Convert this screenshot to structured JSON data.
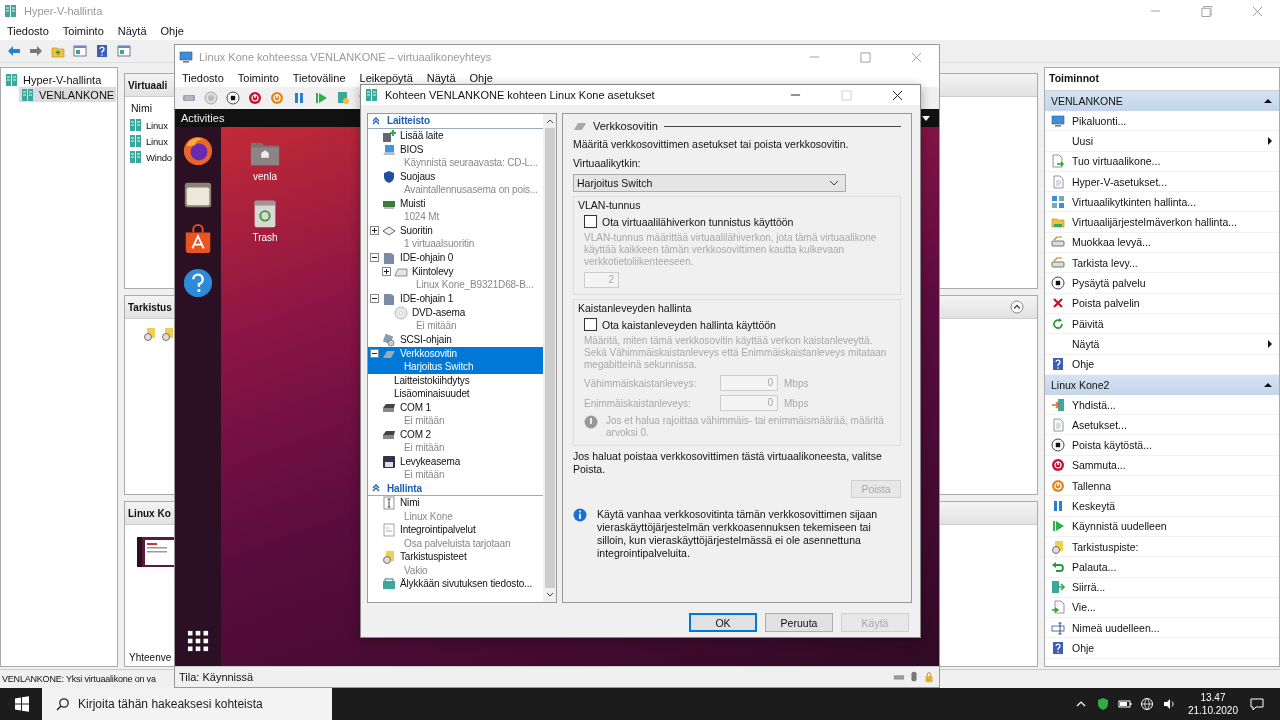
{
  "manager": {
    "title": "Hyper-V-hallinta",
    "menu": [
      "Tiedosto",
      "Toiminto",
      "Näytä",
      "Ohje"
    ],
    "tree": [
      {
        "label": "Hyper-V-hallinta",
        "selected": false,
        "children": [
          {
            "label": "VENLANKONE",
            "selected": true
          }
        ]
      }
    ],
    "vm_pane": {
      "title": "Virtuaali",
      "header": "Nimi",
      "rows": [
        "Linux",
        "Linux",
        "Windo"
      ]
    },
    "checkpoint_pane": {
      "title": "Tarkistus"
    },
    "details_pane": {
      "title": "Linux Ko",
      "footer": "Yhteenve"
    },
    "actions": {
      "title": "Toiminnot",
      "groups": [
        {
          "title": "VENLANKONE",
          "expanded": true,
          "items": [
            {
              "label": "Pikaluonti...",
              "submenu": false
            },
            {
              "label": "Uusi",
              "submenu": true
            },
            {
              "label": "Tuo virtuaalikone...",
              "submenu": false
            },
            {
              "label": "Hyper-V-asetukset...",
              "submenu": false
            },
            {
              "label": "Virtuaalikytkinten hallinta...",
              "submenu": false
            },
            {
              "label": "Virtuaalijärjestelmäverkon hallinta...",
              "submenu": false
            },
            {
              "label": "Muokkaa levyä...",
              "submenu": false
            },
            {
              "label": "Tarkista levy...",
              "submenu": false
            },
            {
              "label": "Pysäytä palvelu",
              "submenu": false
            },
            {
              "label": "Poista palvelin",
              "submenu": false
            },
            {
              "label": "Päivitä",
              "submenu": false
            },
            {
              "label": "Näytä",
              "submenu": true
            },
            {
              "label": "Ohje",
              "submenu": false
            }
          ]
        },
        {
          "title": "Linux Kone2",
          "expanded": true,
          "items": [
            {
              "label": "Yhdistä...",
              "submenu": false
            },
            {
              "label": "Asetukset...",
              "submenu": false
            },
            {
              "label": "Poista käytöstä...",
              "submenu": false
            },
            {
              "label": "Sammuta...",
              "submenu": false
            },
            {
              "label": "Tallenna",
              "submenu": false
            },
            {
              "label": "Keskeytä",
              "submenu": false
            },
            {
              "label": "Käynnistä uudelleen",
              "submenu": false
            },
            {
              "label": "Tarkistuspiste:",
              "submenu": false
            },
            {
              "label": "Palauta...",
              "submenu": false
            },
            {
              "label": "Siirrä...",
              "submenu": false
            },
            {
              "label": "Vie...",
              "submenu": false
            },
            {
              "label": "Nimeä uudelleen...",
              "submenu": false
            },
            {
              "label": "Ohje",
              "submenu": false
            }
          ]
        }
      ]
    },
    "status": "VENLANKONE:  Yksi virtuaalikone on va"
  },
  "vm_window": {
    "title": "Linux Kone kohteessa VENLANKONE – virtuaalikoneyhteys",
    "menu": [
      "Tiedosto",
      "Toiminto",
      "Tietoväline",
      "Leikepöytä",
      "Näytä",
      "Ohje"
    ],
    "top_bar": "Activities",
    "desktop_icons": [
      "venla",
      "Trash"
    ],
    "status": "Tila: Käynnissä"
  },
  "settings": {
    "title": "Kohteen VENLANKONE kohteen Linux Kone asetukset",
    "sections": [
      {
        "title": "Laitteisto",
        "expanded": true,
        "items": [
          {
            "label": "Lisää laite",
            "selected": false
          },
          {
            "label": "BIOS",
            "detail": "Käynnistä seuraavasta: CD-L...",
            "selected": false
          },
          {
            "label": "Suojaus",
            "detail": "Avaintallennusasema on pois...",
            "selected": false
          },
          {
            "label": "Muisti",
            "detail": "1024 Mt",
            "selected": false
          },
          {
            "label": "Suoritin",
            "detail": "1 virtuaalsuoritin",
            "selected": false,
            "expanded": false
          },
          {
            "label": "IDE-ohjain 0",
            "selected": false,
            "expanded": true,
            "children": [
              {
                "label": "Kiintolevy",
                "detail": "Linux Kone_B9321D68-B...",
                "selected": false,
                "expanded": false
              }
            ]
          },
          {
            "label": "IDE-ohjain 1",
            "selected": false,
            "expanded": true,
            "children": [
              {
                "label": "DVD-asema",
                "detail": "Ei mitään",
                "selected": false
              }
            ]
          },
          {
            "label": "SCSI-ohjain",
            "selected": false
          },
          {
            "label": "Verkkosovitin",
            "detail": "Harjoitus Switch",
            "selected": true,
            "expanded": true,
            "children": [
              {
                "label": "Laitteistokiihdytys",
                "selected": false
              },
              {
                "label": "Lisäominaisuudet",
                "selected": false
              }
            ]
          },
          {
            "label": "COM 1",
            "detail": "Ei mitään",
            "selected": false
          },
          {
            "label": "COM 2",
            "detail": "Ei mitään",
            "selected": false
          },
          {
            "label": "Levykeasema",
            "detail": "Ei mitään",
            "selected": false
          }
        ]
      },
      {
        "title": "Hallinta",
        "expanded": true,
        "items": [
          {
            "label": "Nimi",
            "detail": "Linux Kone",
            "selected": false
          },
          {
            "label": "Integrointipalvelut",
            "detail": "Osa palveluista tarjotaan",
            "selected": false
          },
          {
            "label": "Tarkistuspisteet",
            "detail": "Vakio",
            "selected": false
          },
          {
            "label": "Älykkään sivutuksen tiedosto...",
            "selected": false
          }
        ]
      }
    ],
    "adapter": {
      "heading": "Verkkosovitin",
      "intro": "Määritä verkkosovittimen asetukset tai poista verkkosovitin.",
      "switch_label": "Virtuaalikytkin:",
      "switch_value": "Harjoitus Switch",
      "vlan": {
        "title": "VLAN-tunnus",
        "checkbox": {
          "label": "Ota virtuaalilähiverkon tunnistus käyttöön",
          "checked": false
        },
        "disabled": true,
        "note": "VLAN-tunnus määrittää virtuaalilähiverkon, jota tämä virtuaalikone käyttää kaikkeen tämän verkkosovittimen kautta kulkevaan verkkotietoliikenteeseen.",
        "value": "2"
      },
      "bandwidth": {
        "title": "Kaistanleveyden hallinta",
        "checkbox": {
          "label": "Ota kaistanleveyden hallinta käyttöön",
          "checked": false
        },
        "disabled": true,
        "note": "Määritä, miten tämä verkkosovitin käyttää verkon kaistanleveyttä. Sekä Vähimmäiskaistanleveys että Enimmäiskaistanleveys mitataan megabitteinä sekunnissa.",
        "fields": [
          {
            "label": "Vähimmäiskaistanleveys:",
            "value": "0",
            "unit": "Mbps"
          },
          {
            "label": "Enimmäiskaistanleveys:",
            "value": "0",
            "unit": "Mbps"
          }
        ],
        "hint": "Jos et halua rajoittaa vähimmäis- tai enimmäismäärää, määritä arvoksi 0."
      },
      "remove_text": "Jos haluat poistaa verkkosovittimen tästä virtuaalikoneesta, valitse Poista.",
      "remove_button": {
        "label": "Poista",
        "disabled": true
      },
      "info": "Käytä vanhaa verkkosovitinta tämän verkkosovittimen sijaan vieraskäyttöjärjestelmän verkkoasennuksen tekemiseen tai silloin, kun vieraskäyttöjärjestelmässä ei ole asennettuna integrointipalveluita."
    },
    "buttons": [
      {
        "label": "OK",
        "disabled": false,
        "default": true
      },
      {
        "label": "Peruuta",
        "disabled": false,
        "default": false
      },
      {
        "label": "Käytä",
        "disabled": true,
        "default": false
      }
    ]
  },
  "taskbar": {
    "search_placeholder": "Kirjoita tähän hakeaksesi kohteista",
    "time": "13.47",
    "date": "21.10.2020"
  }
}
